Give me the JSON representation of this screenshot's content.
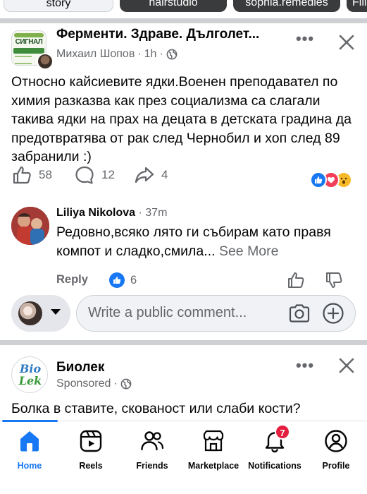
{
  "stories": {
    "items": [
      {
        "label": "story"
      },
      {
        "label": "hairstudio"
      },
      {
        "label": "sophia.remedies"
      },
      {
        "label": "Fili"
      }
    ]
  },
  "post": {
    "group_name": "Ферменти. Здраве. Дълголет...",
    "author": "Михаил Шопов",
    "time": "1h",
    "separator": "·",
    "text": "Относно кайсиевите ядки.Военен преподавател по химия разказва как през социализма са слагали такива ядки на прах на децата в детската градина  да предотвратява от рак след Чернобил и хоп след 89 забранили :)",
    "likes": "58",
    "comments": "12",
    "shares": "4",
    "reactions": [
      "like",
      "love",
      "wow"
    ]
  },
  "comment": {
    "author": "Liliya Nikolova",
    "time": "· 37m",
    "text": "Редовно,всяко лято ги събирам като правя компот и сладко,смила...",
    "see_more": "See More",
    "reply_label": "Reply",
    "likes": "6"
  },
  "composer": {
    "placeholder": "Write a public comment..."
  },
  "sponsored": {
    "name": "Биолек",
    "logo_top": "Bio",
    "logo_bottom": "Lek",
    "label": "Sponsored",
    "separator": "·",
    "text": "Болка в ставите, скованост или слаби кости?"
  },
  "nav": {
    "items": [
      {
        "label": "Home",
        "icon": "home-icon",
        "active": true
      },
      {
        "label": "Reels",
        "icon": "reels-icon"
      },
      {
        "label": "Friends",
        "icon": "friends-icon"
      },
      {
        "label": "Marketplace",
        "icon": "marketplace-icon"
      },
      {
        "label": "Notifications",
        "icon": "bell-icon",
        "badge": "7"
      },
      {
        "label": "Profile",
        "icon": "profile-icon"
      }
    ]
  },
  "colors": {
    "accent": "#1877f2",
    "badge": "#e41e3f",
    "muted_text": "#65676b",
    "divider": "#ced0d4"
  }
}
